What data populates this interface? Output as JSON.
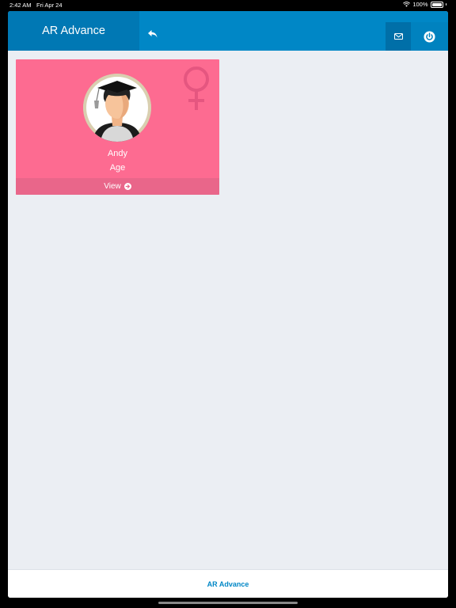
{
  "status_bar": {
    "time": "2:42 AM",
    "date": "Fri Apr 24",
    "battery": "100%"
  },
  "header": {
    "title": "AR Advance",
    "back_icon": "reply-arrow-icon",
    "mail_icon": "envelope-icon",
    "power_icon": "power-icon"
  },
  "card": {
    "name": "Andy",
    "age_label": "Age",
    "view_label": "View",
    "gender": "female",
    "gender_icon": "venus-icon",
    "background": "#fd6b91"
  },
  "footer": {
    "label": "AR Advance"
  },
  "colors": {
    "primary": "#0087c6",
    "brand_bg": "#0078b4",
    "content_bg": "#ebeef3"
  }
}
